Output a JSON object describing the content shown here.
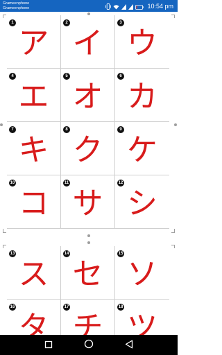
{
  "status_bar": {
    "carrier_line1": "Grameenphone",
    "carrier_line2": "Grameenphone",
    "battery": "10%",
    "time": "10:54 pm",
    "icons": [
      "vibrate-icon",
      "wifi-icon",
      "signal-icon",
      "signal-icon",
      "battery-icon"
    ]
  },
  "worksheet": {
    "sheet1": [
      {
        "num": "1",
        "kana": "ア"
      },
      {
        "num": "2",
        "kana": "イ"
      },
      {
        "num": "3",
        "kana": "ウ"
      },
      {
        "num": "4",
        "kana": "エ"
      },
      {
        "num": "5",
        "kana": "オ"
      },
      {
        "num": "6",
        "kana": "カ"
      },
      {
        "num": "7",
        "kana": "キ"
      },
      {
        "num": "8",
        "kana": "ク"
      },
      {
        "num": "9",
        "kana": "ケ"
      },
      {
        "num": "10",
        "kana": "コ"
      },
      {
        "num": "11",
        "kana": "サ"
      },
      {
        "num": "12",
        "kana": "シ"
      }
    ],
    "sheet2": [
      {
        "num": "13",
        "kana": "ス"
      },
      {
        "num": "14",
        "kana": "セ"
      },
      {
        "num": "15",
        "kana": "ソ"
      },
      {
        "num": "16",
        "kana": "タ"
      },
      {
        "num": "17",
        "kana": "チ"
      },
      {
        "num": "18",
        "kana": "ツ"
      }
    ],
    "number_badge_color": "#111111",
    "kana_color": "#d81b1b"
  },
  "nav_bar": {
    "buttons": [
      "recents-square-icon",
      "home-circle-icon",
      "back-triangle-icon"
    ]
  },
  "colors": {
    "status_bar": "#1565c0",
    "nav_bar": "#000000",
    "grid_line": "#cfcfcf"
  }
}
